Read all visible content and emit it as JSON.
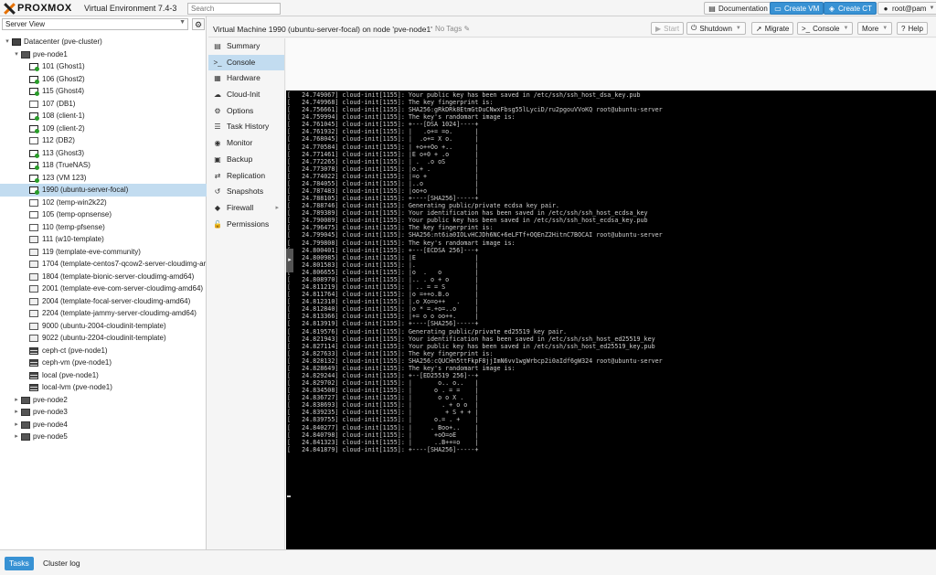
{
  "app": {
    "brand": "PROXMOX",
    "version_label": "Virtual Environment 7.4-3",
    "search_placeholder": "Search"
  },
  "topbar": {
    "documentation": "Documentation",
    "create_vm": "Create VM",
    "create_ct": "Create CT",
    "user": "root@pam"
  },
  "tree": {
    "view_selector": "Server View",
    "items": [
      {
        "label": "Datacenter (pve-cluster)",
        "type": "datacenter",
        "indent": 0,
        "expander": "minus"
      },
      {
        "label": "pve-node1",
        "type": "node",
        "indent": 1,
        "expander": "minus"
      },
      {
        "label": "101 (Ghost1)",
        "type": "vm-run",
        "indent": 2
      },
      {
        "label": "106 (Ghost2)",
        "type": "vm-run",
        "indent": 2
      },
      {
        "label": "115 (Ghost4)",
        "type": "vm-run",
        "indent": 2
      },
      {
        "label": "107 (DB1)",
        "type": "vm-off",
        "indent": 2
      },
      {
        "label": "108 (client-1)",
        "type": "vm-run",
        "indent": 2
      },
      {
        "label": "109 (client-2)",
        "type": "vm-run",
        "indent": 2
      },
      {
        "label": "112 (DB2)",
        "type": "vm-off",
        "indent": 2
      },
      {
        "label": "113 (Ghost3)",
        "type": "vm-run",
        "indent": 2
      },
      {
        "label": "118 (TrueNAS)",
        "type": "vm-run",
        "indent": 2
      },
      {
        "label": "123 (VM 123)",
        "type": "vm-run",
        "indent": 2
      },
      {
        "label": "1990 (ubuntu-server-focal)",
        "type": "vm-run",
        "indent": 2,
        "selected": true
      },
      {
        "label": "102 (temp-win2k22)",
        "type": "vm-off",
        "indent": 2
      },
      {
        "label": "105 (temp-opnsense)",
        "type": "vm-off",
        "indent": 2
      },
      {
        "label": "110 (temp-pfsense)",
        "type": "vm-off",
        "indent": 2
      },
      {
        "label": "111 (w10-template)",
        "type": "tpl",
        "indent": 2
      },
      {
        "label": "119 (template-eve-community)",
        "type": "tpl",
        "indent": 2
      },
      {
        "label": "1704 (template-centos7-qcow2-server-cloudimg-ar",
        "type": "tpl",
        "indent": 2
      },
      {
        "label": "1804 (template-bionic-server-cloudimg-amd64)",
        "type": "tpl",
        "indent": 2
      },
      {
        "label": "2001 (template-eve-com-server-cloudimg-amd64)",
        "type": "tpl",
        "indent": 2
      },
      {
        "label": "2004 (template-focal-server-cloudimg-amd64)",
        "type": "tpl",
        "indent": 2
      },
      {
        "label": "2204 (template-jammy-server-cloudimg-amd64)",
        "type": "tpl",
        "indent": 2
      },
      {
        "label": "9000 (ubuntu-2004-cloudinit-template)",
        "type": "tpl",
        "indent": 2
      },
      {
        "label": "9022 (ubuntu-2204-cloudinit-template)",
        "type": "tpl",
        "indent": 2
      },
      {
        "label": "ceph-ct (pve-node1)",
        "type": "store",
        "indent": 2
      },
      {
        "label": "ceph-vm (pve-node1)",
        "type": "store",
        "indent": 2
      },
      {
        "label": "local (pve-node1)",
        "type": "store",
        "indent": 2
      },
      {
        "label": "local-lvm (pve-node1)",
        "type": "store",
        "indent": 2
      },
      {
        "label": "pve-node2",
        "type": "node",
        "indent": 1,
        "expander": "plus"
      },
      {
        "label": "pve-node3",
        "type": "node",
        "indent": 1,
        "expander": "plus"
      },
      {
        "label": "pve-node4",
        "type": "node",
        "indent": 1,
        "expander": "plus"
      },
      {
        "label": "pve-node5",
        "type": "node",
        "indent": 1,
        "expander": "plus"
      }
    ]
  },
  "header": {
    "title": "Virtual Machine 1990 (ubuntu-server-focal) on node 'pve-node1'",
    "tags": "No Tags",
    "start": "Start",
    "shutdown": "Shutdown",
    "migrate": "Migrate",
    "console": "Console",
    "more": "More",
    "help": "Help"
  },
  "menu": [
    {
      "label": "Summary",
      "icon": "summary-icon",
      "glyph": "▤"
    },
    {
      "label": "Console",
      "icon": "console-icon",
      "glyph": ">_",
      "active": true
    },
    {
      "label": "Hardware",
      "icon": "hardware-icon",
      "glyph": "▦"
    },
    {
      "label": "Cloud-Init",
      "icon": "cloud-icon",
      "glyph": "☁"
    },
    {
      "label": "Options",
      "icon": "gear-icon",
      "glyph": "⚙"
    },
    {
      "label": "Task History",
      "icon": "list-icon",
      "glyph": "☰"
    },
    {
      "label": "Monitor",
      "icon": "eye-icon",
      "glyph": "◉"
    },
    {
      "label": "Backup",
      "icon": "floppy-icon",
      "glyph": "▣"
    },
    {
      "label": "Replication",
      "icon": "retweet-icon",
      "glyph": "⇄"
    },
    {
      "label": "Snapshots",
      "icon": "history-icon",
      "glyph": "↺"
    },
    {
      "label": "Firewall",
      "icon": "shield-icon",
      "glyph": "◆",
      "submenu": true
    },
    {
      "label": "Permissions",
      "icon": "unlock-icon",
      "glyph": "🔓"
    }
  ],
  "console_lines": [
    "[   24.749067] cloud-init[1155]: Your public key has been saved in /etc/ssh/ssh_host_dsa_key.pub",
    "[   24.749968] cloud-init[1155]: The key fingerprint is:",
    "[   24.756661] cloud-init[1155]: SHA256:gRkDRk8EtmGtDuCNwxFbsg55lLyciD/ru2pgouVVoKQ root@ubuntu-server",
    "[   24.759994] cloud-init[1155]: The key's randomart image is:",
    "[   24.761045] cloud-init[1155]: +---[DSA 1024]----+",
    "[   24.761932] cloud-init[1155]: |   .o+= =o.      |",
    "[   24.768045] cloud-init[1155]: |  .o+= X o.      |",
    "[   24.770584] cloud-init[1155]: | +o++Oo +..      |",
    "[   24.771461] cloud-init[1155]: |E o+0 + .o       |",
    "[   24.772265] cloud-init[1155]: | .  .o oS        |",
    "[   24.773078] cloud-init[1155]: |o.+ .            |",
    "[   24.774022] cloud-init[1155]: |=o +             |",
    "[   24.784055] cloud-init[1155]: |..o              |",
    "[   24.787483] cloud-init[1155]: |oo+o             |",
    "[   24.788105] cloud-init[1155]: +----[SHA256]-----+",
    "[   24.788746] cloud-init[1155]: Generating public/private ecdsa key pair.",
    "[   24.789389] cloud-init[1155]: Your identification has been saved in /etc/ssh/ssh_host_ecdsa_key",
    "[   24.790089] cloud-init[1155]: Your public key has been saved in /etc/ssh/ssh_host_ecdsa_key.pub",
    "[   24.796475] cloud-init[1155]: The key fingerprint is:",
    "[   24.799045] cloud-init[1155]: SHA256:nt6ia0IOLvHCJDh6NC+6eLFTf+OQEnZ2HitnC7BOCAI root@ubuntu-server",
    "[   24.799808] cloud-init[1155]: The key's randomart image is:",
    "[   24.800401] cloud-init[1155]: +---[ECDSA 256]---+",
    "[   24.800985] cloud-init[1155]: |E                |",
    "[   24.801583] cloud-init[1155]: |.                |",
    "[   24.806655] cloud-init[1155]: |o  .   o         |",
    "[   24.808970] cloud-init[1155]: |.. . o + o       |",
    "[   24.811219] cloud-init[1155]: | .. = = S        |",
    "[   24.811764] cloud-init[1155]: |o =++o.B.o       |",
    "[   24.812310] cloud-init[1155]: |.o Xo=o++   .    |",
    "[   24.812840] cloud-init[1155]: |o * =.+o=..o     |",
    "[   24.813366] cloud-init[1155]: |+= o o oo++.     |",
    "[   24.813919] cloud-init[1155]: +----[SHA256]-----+",
    "[   24.819576] cloud-init[1155]: Generating public/private ed25519 key pair.",
    "[   24.821943] cloud-init[1155]: Your identification has been saved in /etc/ssh/ssh_host_ed25519_key",
    "[   24.827114] cloud-init[1155]: Your public key has been saved in /etc/ssh/ssh_host_ed25519_key.pub",
    "[   24.827633] cloud-init[1155]: The key fingerprint is:",
    "[   24.828132] cloud-init[1155]: SHA256:cQUCHn5ttFkpF8jjImN6vv1wgWrbcp2i0aIdf6gW324 root@ubuntu-server",
    "[   24.828649] cloud-init[1155]: The key's randomart image is:",
    "[   24.829244] cloud-init[1155]: +--[ED25519 256]--+",
    "[   24.829702] cloud-init[1155]: |       o.. o..   |",
    "[   24.834508] cloud-init[1155]: |      o . = =    |",
    "[   24.836727] cloud-init[1155]: |       o o X .   |",
    "[   24.838693] cloud-init[1155]: |        . + o o  |",
    "[   24.839235] cloud-init[1155]: |         + S + + |",
    "[   24.839755] cloud-init[1155]: |      o.= . +    |",
    "[   24.840277] cloud-init[1155]: |     . Boo+..    |",
    "[   24.840798] cloud-init[1155]: |      +oO=oE     |",
    "[   24.841323] cloud-init[1155]: |      ..B++=o    |",
    "[   24.841879] cloud-init[1155]: +----[SHA256]-----+"
  ],
  "bottom": {
    "tasks": "Tasks",
    "cluster_log": "Cluster log"
  }
}
